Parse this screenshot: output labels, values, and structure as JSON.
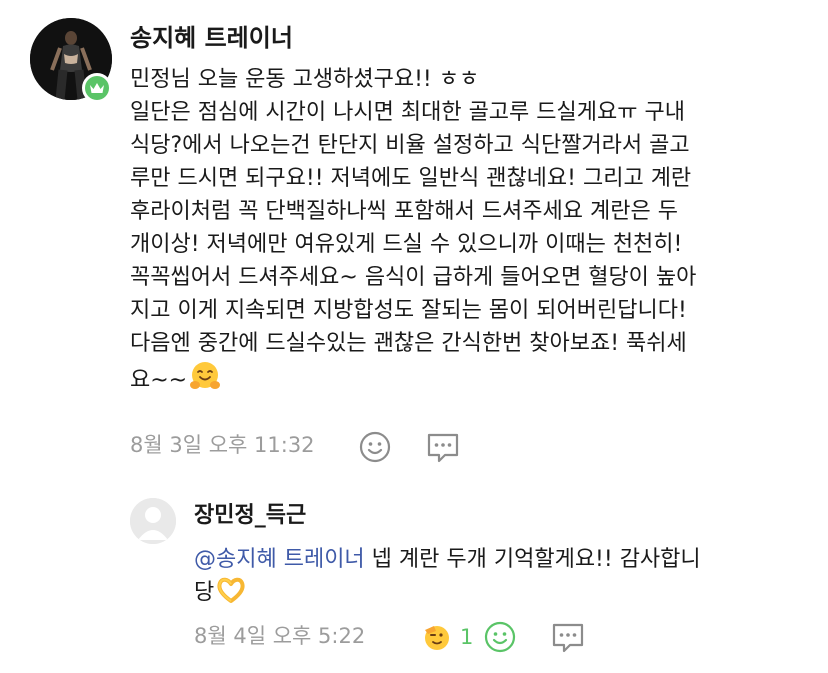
{
  "comment": {
    "author": "송지혜 트레이너",
    "lines": [
      "민정님 오늘 운동 고생하셨구요!! ㅎㅎ",
      "일단은 점심에 시간이 나시면 최대한 골고루 드실게요ㅠ 구내",
      "식당?에서 나오는건 탄단지 비율 설정하고 식단짤거라서 골고",
      "루만 드시면 되구요!! 저녁에도 일반식 괜찮네요! 그리고 계란",
      "후라이처럼 꼭 단백질하나씩 포함해서 드셔주세요 계란은 두",
      "개이상! 저녁에만 여유있게 드실 수 있으니까 이때는 천천히!",
      "꼭꼭씹어서 드셔주세요~ 음식이 급하게 들어오면 혈당이 높아",
      "지고 이게 지속되면 지방합성도 잘되는 몸이 되어버린답니다!",
      "다음엔 중간에 드실수있는 괜찮은 간식한번 찾아보죠! 푹쉬세",
      "요~~"
    ],
    "timestamp": "8월 3일 오후 11:32",
    "icons": {
      "badge": "crown-icon",
      "emoji": "hugging-face-emoji",
      "react": "smiley-reaction-icon",
      "reply": "comment-reply-icon"
    }
  },
  "reply": {
    "author": "장민정_득근",
    "mention": "@송지혜 트레이너",
    "text_line1": " 넵 계란 두개 기억할게요!! 감사합니",
    "text_line2": "당",
    "timestamp": "8월 4일 오후 5:22",
    "reaction_count": "1",
    "icons": {
      "avatar": "default-profile-icon",
      "emoji": "heart-hands-emoji",
      "reaction": "saluting-face-emoji",
      "react": "smiley-reaction-icon",
      "reply": "comment-reply-icon"
    }
  },
  "colors": {
    "accent_green": "#5ac467",
    "mention_blue": "#3f5aa8",
    "meta_gray": "#9c9c9c"
  }
}
